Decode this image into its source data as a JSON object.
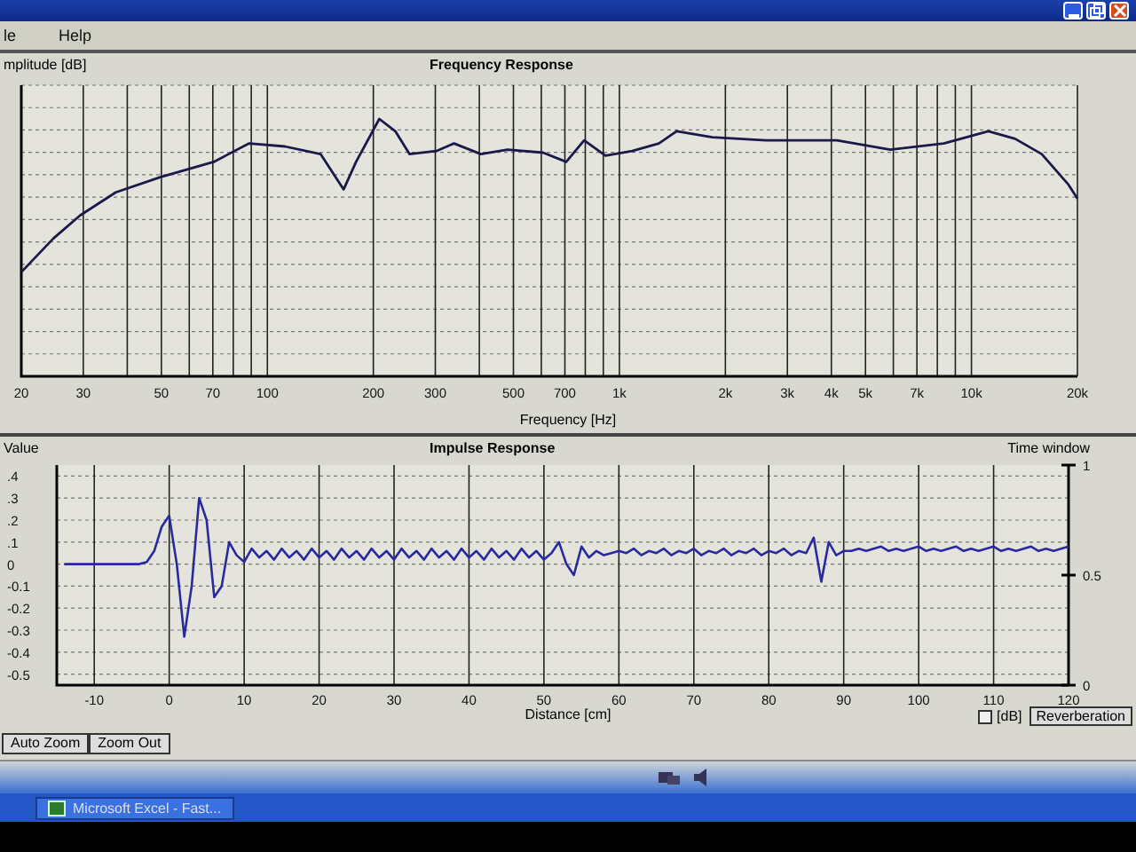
{
  "menu": [
    {
      "label": "le"
    },
    {
      "label": "Help"
    }
  ],
  "frequency_response": {
    "title": "Frequency Response",
    "ylabel": "mplitude [dB]",
    "xlabel": "Frequency [Hz]",
    "xticks": [
      "20",
      "30",
      "50",
      "70",
      "100",
      "200",
      "300",
      "500",
      "700",
      "1k",
      "2k",
      "3k",
      "4k",
      "5k",
      "7k",
      "10k",
      "20k"
    ]
  },
  "impulse_response": {
    "right_label": "Time window",
    "right_ticks": [
      "1",
      "0.5",
      "0"
    ],
    "chart_data": {
      "type": "line",
      "grid": true,
      "title": "Impulse Response",
      "xlabel": "Distance [cm]",
      "ylabel": "Value",
      "xlim": [
        -15,
        120
      ],
      "ylim": [
        -0.55,
        0.45
      ],
      "xticks": [
        -10,
        0,
        10,
        20,
        30,
        40,
        50,
        60,
        70,
        80,
        90,
        100,
        110,
        120
      ],
      "yticks": [
        {
          "value": 0.4,
          "label": ".4"
        },
        {
          "value": 0.3,
          "label": ".3"
        },
        {
          "value": 0.2,
          "label": ".2"
        },
        {
          "value": 0.1,
          "label": ".1"
        },
        {
          "value": 0,
          "label": "0"
        },
        {
          "value": -0.1,
          "label": "-0.1"
        },
        {
          "value": -0.2,
          "label": "-0.2"
        },
        {
          "value": -0.3,
          "label": "-0.3"
        },
        {
          "value": -0.4,
          "label": "-0.4"
        },
        {
          "value": -0.5,
          "label": "-0.5"
        }
      ],
      "x": [
        -14,
        -13,
        -12,
        -11,
        -10,
        -9,
        -8,
        -7,
        -6,
        -5,
        -4,
        -3,
        -2,
        -1,
        0,
        1,
        2,
        3,
        4,
        5,
        6,
        7,
        8,
        9,
        10,
        11,
        12,
        13,
        14,
        15,
        16,
        17,
        18,
        19,
        20,
        21,
        22,
        23,
        24,
        25,
        26,
        27,
        28,
        29,
        30,
        31,
        32,
        33,
        34,
        35,
        36,
        37,
        38,
        39,
        40,
        41,
        42,
        43,
        44,
        45,
        46,
        47,
        48,
        49,
        50,
        51,
        52,
        53,
        54,
        55,
        56,
        57,
        58,
        59,
        60,
        61,
        62,
        63,
        64,
        65,
        66,
        67,
        68,
        69,
        70,
        71,
        72,
        73,
        74,
        75,
        76,
        77,
        78,
        79,
        80,
        81,
        82,
        83,
        84,
        85,
        86,
        87,
        88,
        89,
        90,
        91,
        92,
        93,
        94,
        95,
        96,
        97,
        98,
        99,
        100,
        101,
        102,
        103,
        104,
        105,
        106,
        107,
        108,
        109,
        110,
        111,
        112,
        113,
        114,
        115,
        116,
        117,
        118,
        119,
        120
      ],
      "series": [
        {
          "color": "#2a2aa0",
          "values": [
            0,
            0,
            0,
            0,
            0,
            0,
            0,
            0,
            0,
            0,
            0,
            0.01,
            0.06,
            0.17,
            0.22,
            0,
            -0.33,
            -0.1,
            0.3,
            0.2,
            -0.15,
            -0.1,
            0.1,
            0.04,
            0.01,
            0.07,
            0.03,
            0.06,
            0.02,
            0.07,
            0.03,
            0.06,
            0.02,
            0.07,
            0.03,
            0.06,
            0.02,
            0.07,
            0.03,
            0.06,
            0.02,
            0.07,
            0.03,
            0.06,
            0.02,
            0.07,
            0.03,
            0.06,
            0.02,
            0.07,
            0.03,
            0.06,
            0.02,
            0.07,
            0.03,
            0.06,
            0.02,
            0.07,
            0.03,
            0.06,
            0.02,
            0.07,
            0.03,
            0.06,
            0.02,
            0.05,
            0.1,
            0,
            -0.05,
            0.08,
            0.03,
            0.06,
            0.04,
            0.05,
            0.06,
            0.05,
            0.07,
            0.04,
            0.06,
            0.05,
            0.07,
            0.04,
            0.06,
            0.05,
            0.07,
            0.04,
            0.06,
            0.05,
            0.07,
            0.04,
            0.06,
            0.05,
            0.07,
            0.04,
            0.06,
            0.05,
            0.07,
            0.04,
            0.06,
            0.05,
            0.12,
            -0.08,
            0.1,
            0.04,
            0.06,
            0.06,
            0.07,
            0.06,
            0.07,
            0.08,
            0.06,
            0.07,
            0.06,
            0.07,
            0.08,
            0.06,
            0.07,
            0.06,
            0.07,
            0.08,
            0.06,
            0.07,
            0.06,
            0.07,
            0.08,
            0.06,
            0.07,
            0.06,
            0.07,
            0.08,
            0.06,
            0.07,
            0.06,
            0.07,
            0.08
          ]
        }
      ]
    }
  },
  "buttons": [
    {
      "label": "Auto Zoom"
    },
    {
      "label": "Zoom Out"
    }
  ],
  "db_checkbox": {
    "label": "[dB]",
    "checked": false
  },
  "reverberation_button": {
    "label": "Reverberation"
  },
  "taskbar": {
    "tasks": [
      {
        "label": "Microsoft Excel - Fast...",
        "selected": false
      }
    ]
  }
}
